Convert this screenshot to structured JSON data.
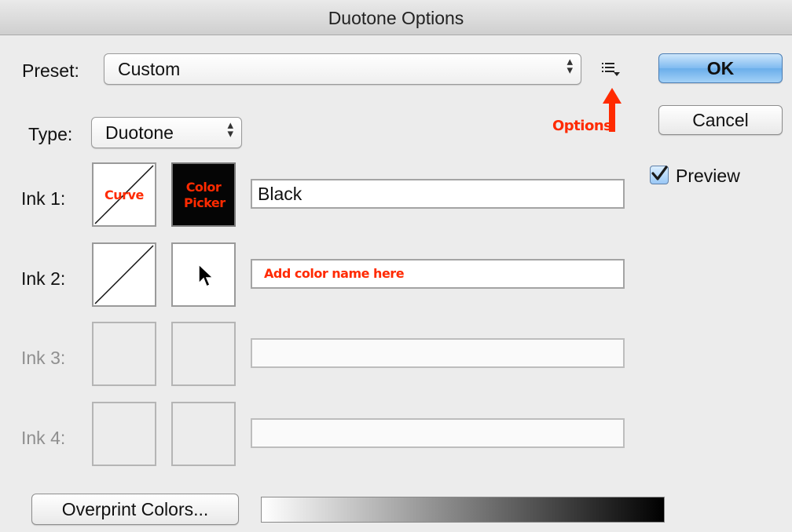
{
  "window": {
    "title": "Duotone Options"
  },
  "preset": {
    "label": "Preset:",
    "value": "Custom"
  },
  "type": {
    "label": "Type:",
    "value": "Duotone"
  },
  "buttons": {
    "ok": "OK",
    "cancel": "Cancel",
    "overprint": "Overprint Colors..."
  },
  "preview": {
    "label": "Preview",
    "checked": true
  },
  "inks": [
    {
      "label": "Ink 1:",
      "name": "Black",
      "swatch_color": "#000000",
      "enabled": true
    },
    {
      "label": "Ink 2:",
      "name": "",
      "swatch_color": "#ffffff",
      "enabled": true
    },
    {
      "label": "Ink 3:",
      "name": "",
      "enabled": false
    },
    {
      "label": "Ink 4:",
      "name": "",
      "enabled": false
    }
  ],
  "annotations": {
    "options": "Options",
    "curve": "Curve",
    "color_picker_line1": "Color",
    "color_picker_line2": "Picker",
    "add_color_name": "Add color name here",
    "color": "#ff2a00"
  },
  "icons": {
    "options_menu": "list-menu-icon",
    "cursor": "mouse-pointer-icon",
    "checkbox": "checkmark-icon",
    "popup_arrows": "updown-arrows-icon"
  },
  "colors": {
    "default_button": "#6aaeea",
    "dialog_bg": "#ececec"
  }
}
